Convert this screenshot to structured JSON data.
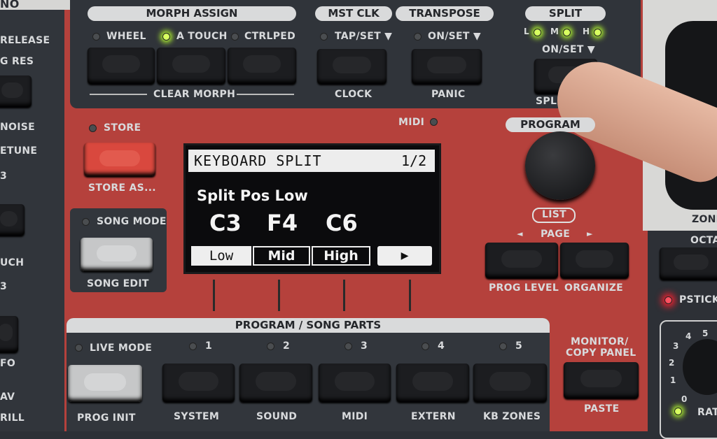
{
  "left_strip": {
    "top": "NO",
    "labels": [
      "RELEASE",
      "G RES",
      "NOISE",
      "ETUNE",
      "3",
      "UCH",
      "3",
      "FO",
      "AV",
      "RILL"
    ]
  },
  "morph_assign": {
    "title": "MORPH ASSIGN",
    "leds": [
      {
        "label": "WHEEL",
        "lit": false
      },
      {
        "label": "A TOUCH",
        "lit": true
      },
      {
        "label": "CTRLPED",
        "lit": false
      }
    ],
    "footer": "CLEAR MORPH"
  },
  "mst_clk": {
    "title": "MST CLK",
    "led_label": "TAP/SET ▼",
    "footer": "CLOCK"
  },
  "transpose": {
    "title": "TRANSPOSE",
    "led_label": "ON/SET ▼",
    "footer": "PANIC"
  },
  "split": {
    "title": "SPLIT",
    "leds": [
      {
        "label": "L",
        "lit": true
      },
      {
        "label": "M",
        "lit": true
      },
      {
        "label": "H",
        "lit": true
      }
    ],
    "led_label": "ON/SET ▼",
    "footer": "SPLIT"
  },
  "store": {
    "led_label": "STORE",
    "footer": "STORE AS..."
  },
  "song_mode": {
    "led_label": "SONG MODE",
    "footer": "SONG EDIT"
  },
  "midi_led": "MIDI",
  "display": {
    "header": "KEYBOARD SPLIT",
    "page": "1/2",
    "param": "Split Pos Low",
    "values": [
      "C3",
      "F4",
      "C6"
    ],
    "tabs": [
      "Low",
      "Mid",
      "High"
    ],
    "selected_tab": "Low",
    "arrow": "▶"
  },
  "program": {
    "title": "PROGRAM",
    "list": "LIST",
    "page": "PAGE",
    "page_left": "◄",
    "page_right": "►",
    "buttons": [
      "PROG LEVEL",
      "ORGANIZE"
    ]
  },
  "parts": {
    "title": "PROGRAM / SONG PARTS",
    "live_mode": "LIVE MODE",
    "numbers": [
      "1",
      "2",
      "3",
      "4",
      "5"
    ],
    "buttons": [
      "PROG INIT",
      "SYSTEM",
      "SOUND",
      "MIDI",
      "EXTERN",
      "KB ZONES"
    ]
  },
  "monitor": {
    "title_line1": "MONITOR/",
    "title_line2": "COPY PANEL",
    "footer": "PASTE"
  },
  "right_strip": {
    "zone": "ZONE",
    "octave": "OCTA",
    "pstick": "PSTICK",
    "rate_scale": [
      "0",
      "1",
      "2",
      "3",
      "4",
      "5"
    ],
    "rate": "RAT"
  },
  "colors": {
    "panel_red": "#b83a36",
    "panel_dark": "#2c3036",
    "led_green": "#d8ff60",
    "led_red": "#ff5060"
  }
}
